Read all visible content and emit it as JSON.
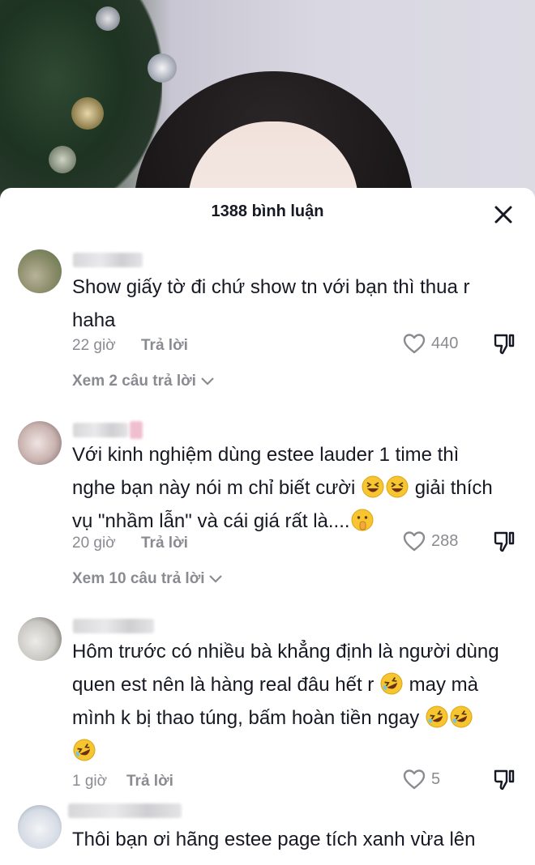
{
  "header": {
    "title": "1388 bình luận"
  },
  "icons": {
    "close": "close-icon",
    "like": "heart-outline-icon",
    "dislike": "thumbs-down-icon",
    "chevron": "chevron-down-icon",
    "laugh_emoji": "grinning-squinting-emoji",
    "rofl_emoji": "rolling-on-floor-laughing-emoji",
    "shush_emoji": "shushing-face-emoji"
  },
  "comments": [
    {
      "text_line1": "Show giấy tờ đi chứ show tn với bạn thì thua r",
      "text_line2": "haha",
      "time": "22 giờ",
      "reply_label": "Trả lời",
      "likes": "440",
      "view_replies": "Xem 2 câu trả lời"
    },
    {
      "text_line1": "Với kinh nghiệm dùng estee lauder 1 time thì",
      "text_line2_a": "nghe bạn này nói m chỉ biết cười",
      "text_line2_b": "giải thích",
      "text_line3": "vụ \"nhầm lẫn\" và cái giá rất là....",
      "time": "20 giờ",
      "reply_label": "Trả lời",
      "likes": "288",
      "view_replies": "Xem 10 câu trả lời"
    },
    {
      "text_line1": "Hôm trước có nhiều bà khẳng định là người dùng",
      "text_line2_a": "quen est nên là hàng real đâu hết r",
      "text_line2_b": "may mà",
      "text_line3": "mình k bị thao túng, bấm hoàn tiền ngay",
      "time": "1 giờ",
      "reply_label": "Trả lời",
      "likes": "5"
    },
    {
      "text_line1": "Thôi bạn ơi hãng estee page tích xanh vừa lên"
    }
  ]
}
